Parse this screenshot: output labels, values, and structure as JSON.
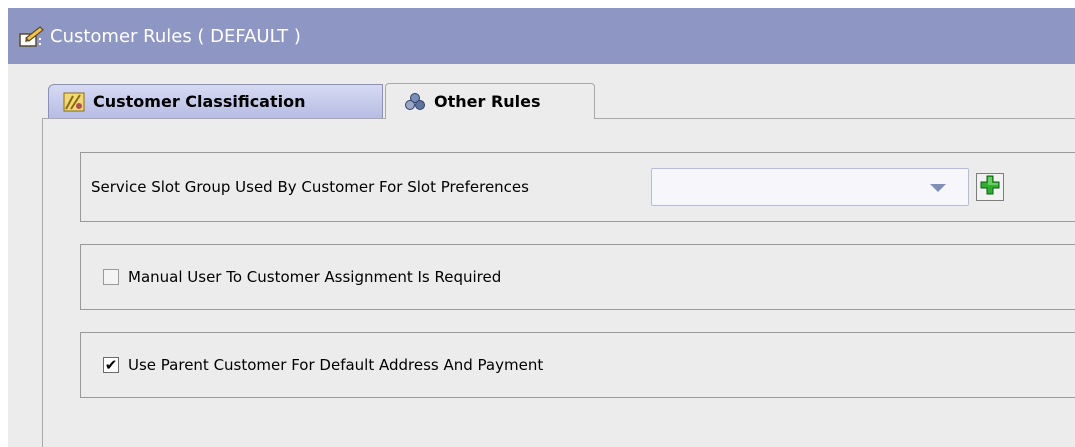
{
  "window": {
    "title": "Customer Rules ( DEFAULT )",
    "icon": "edit-document-icon"
  },
  "tabs": [
    {
      "label": "Customer Classification",
      "icon": "classification-icon",
      "active": false
    },
    {
      "label": "Other Rules",
      "icon": "rules-cluster-icon",
      "active": true
    }
  ],
  "slot_group": {
    "label": "Service Slot Group Used By Customer For Slot Preferences",
    "value": "",
    "add_icon": "green-plus-icon"
  },
  "options": {
    "manual_assignment": {
      "label": "Manual User To Customer Assignment Is Required",
      "checked": false
    },
    "use_parent": {
      "label": "Use Parent Customer For Default Address And Payment",
      "checked": true,
      "mark": "✔"
    }
  },
  "colors": {
    "title_bar": "#8e97c4",
    "panel": "#ececec",
    "tab_inactive": "#c4c9eb"
  }
}
